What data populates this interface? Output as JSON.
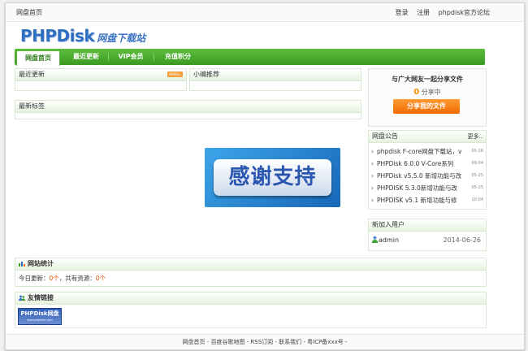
{
  "topbar": {
    "home": "网盘首页",
    "links": [
      "登录",
      "注册",
      "phpdisk官方论坛"
    ]
  },
  "logo": {
    "en": "PHPDisk",
    "cn": "网盘下载站"
  },
  "nav": {
    "items": [
      "网盘首页",
      "最近更新",
      "VIP会员",
      "充值积分"
    ],
    "active": 0
  },
  "recent": {
    "title": "最近更新",
    "more": "MORE»"
  },
  "recommend": {
    "title": "小编推荐"
  },
  "tags": {
    "title": "最新标签"
  },
  "share": {
    "title": "与广大网友一起分享文件",
    "count": "0",
    "count_suffix": "分享中",
    "button": "分享我的文件"
  },
  "notice": {
    "title": "网盘公告",
    "more": "更多..",
    "items": [
      {
        "text": "phpdisk F-core网盘下载站，v",
        "date": "05-26"
      },
      {
        "text": "PHPDisk 6.0.0 V-Core系列",
        "date": "09-04"
      },
      {
        "text": "PHPDisk v5.5.0 新增功能与改",
        "date": "05-25"
      },
      {
        "text": "PHPDISK 5.3.0新增功能与改",
        "date": "05-25"
      },
      {
        "text": "PHPDISK v5.1 新增功能与修",
        "date": "10-04"
      }
    ]
  },
  "new_users": {
    "title": "新加入用户",
    "users": [
      {
        "name": "admin",
        "date": "2014-06-26"
      }
    ]
  },
  "banner": {
    "text": "感谢支持"
  },
  "stats": {
    "title": "网站统计",
    "today_label": "今日更新：",
    "today_value": "0个",
    "total_label": "，共有资源：",
    "total_value": "0个"
  },
  "friends": {
    "title": "友情链接",
    "link_main": "PHPDisk网盘",
    "link_sub": "www.phpdisk.com"
  },
  "footer": {
    "text": "网盘首页 - 百度谷歌地图 - RSS订阅 - 联系我们 - 粤ICP备xxx号 -"
  },
  "colors": {
    "nav_green": "#3c9a23",
    "accent_orange": "#ee6b00",
    "logo_blue": "#2e6fbf"
  }
}
